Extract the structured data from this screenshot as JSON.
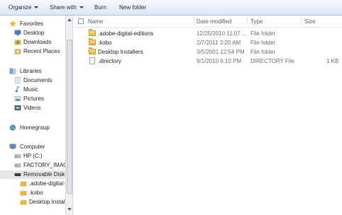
{
  "toolbar": {
    "organize": "Organize",
    "share_with": "Share with",
    "burn": "Burn",
    "new_folder": "New folder"
  },
  "nav": {
    "favorites": "Favorites",
    "desktop": "Desktop",
    "downloads": "Downloads",
    "recent_places": "Recent Places",
    "libraries": "Libraries",
    "documents": "Documents",
    "music": "Music",
    "pictures": "Pictures",
    "videos": "Videos",
    "homegroup": "Homegroup",
    "computer": "Computer",
    "hp_c": "HP (C:)",
    "factory_image": "FACTORY_IMAG",
    "removable_disk": "Removable Disk (",
    "sub_adobe": ".adobe-digital-",
    "sub_kobo": ".kobo",
    "sub_desktop_installers": "Desktop Installe"
  },
  "columns": {
    "name": "Name",
    "date_modified": "Date modified",
    "type": "Type",
    "size": "Size"
  },
  "files": [
    {
      "name": ".adobe-digital-editions",
      "date": "12/25/2010 11:07 ...",
      "type": "File folder",
      "size": "",
      "icon": "folder"
    },
    {
      "name": ".kobo",
      "date": "2/7/2011 3:20 AM",
      "type": "File folder",
      "size": "",
      "icon": "folder"
    },
    {
      "name": "Desktop Installers",
      "date": "3/5/2001 12:54 PM",
      "type": "File folder",
      "size": "",
      "icon": "folder"
    },
    {
      "name": ".directory",
      "date": "9/1/2010 6:10 PM",
      "type": "DIRECTORY File",
      "size": "1 KB",
      "icon": "file"
    }
  ],
  "colors": {
    "toolbar_top": "#f7fafe",
    "toolbar_bottom": "#dbe6f5",
    "header_text": "#4c607a",
    "folder": "#e9b940",
    "selected_row": "#e6e6e6"
  }
}
